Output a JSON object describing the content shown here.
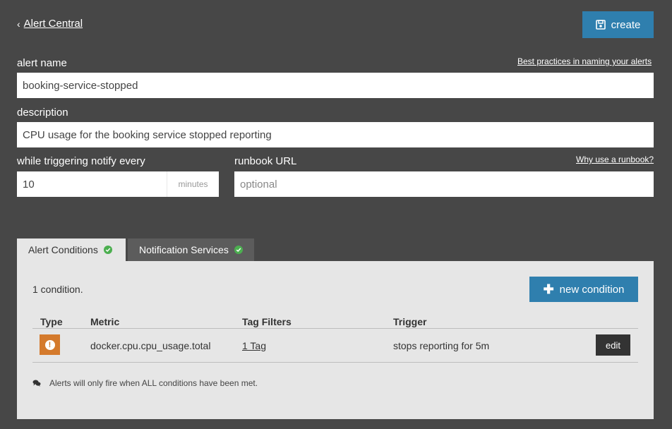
{
  "header": {
    "back_label": "Alert Central",
    "back_icon": "chevron-left-icon",
    "create_label": "create",
    "create_icon": "save-icon"
  },
  "form": {
    "alert_name": {
      "label": "alert name",
      "help_link": "Best practices in naming your alerts",
      "value": "booking-service-stopped"
    },
    "description": {
      "label": "description",
      "value": "CPU usage for the booking service stopped reporting"
    },
    "notify_every": {
      "label": "while triggering notify every",
      "value": "10",
      "unit": "minutes"
    },
    "runbook": {
      "label": "runbook URL",
      "help_link": "Why use a runbook?",
      "value": "",
      "placeholder": "optional"
    }
  },
  "tabs": [
    {
      "label": "Alert Conditions",
      "active": true,
      "status": "check-circle-icon"
    },
    {
      "label": "Notification Services",
      "active": false,
      "status": "check-circle-icon"
    }
  ],
  "conditions": {
    "count_text": "1 condition.",
    "new_button_label": "new condition",
    "columns": [
      "Type",
      "Metric",
      "Tag Filters",
      "Trigger"
    ],
    "rows": [
      {
        "type_icon": "exclamation-circle-icon",
        "metric": "docker.cpu.cpu_usage.total",
        "tag_filters": "1 Tag",
        "trigger": "stops reporting for 5m",
        "edit_label": "edit"
      }
    ],
    "note": "Alerts will only fire when ALL conditions have been met.",
    "note_icon": "comments-icon"
  },
  "colors": {
    "background": "#474747",
    "accent": "#2f7fae",
    "success": "#4caf50",
    "warning": "#d47a2c",
    "panel": "#e6e6e6"
  }
}
